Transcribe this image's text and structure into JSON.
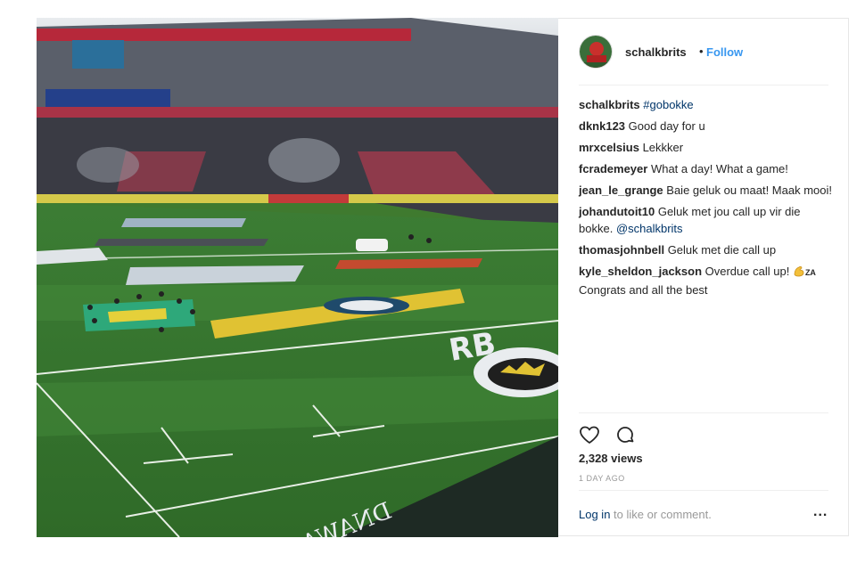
{
  "post": {
    "username": "schalkbrits",
    "separator": "•",
    "follow_label": "Follow",
    "caption": {
      "user": "schalkbrits",
      "hashtag": "#gobokke"
    },
    "comments": [
      {
        "user": "dknk123",
        "text": "Good day for u"
      },
      {
        "user": "mrxcelsius",
        "text": "Lekkker"
      },
      {
        "user": "fcrademeyer",
        "text": "What a day! What a game!"
      },
      {
        "user": "jean_le_grange",
        "text": "Baie geluk ou maat! Maak mooi!"
      },
      {
        "user": "johandutoit10",
        "text": "Geluk met jou call up vir die bokke.",
        "mention": "@schalkbrits"
      },
      {
        "user": "thomasjohnbell",
        "text": "Geluk met die call up"
      },
      {
        "user": "kyle_sheldon_jackson",
        "text": "Overdue call up!",
        "emoji": "flexed-biceps-icon",
        "suffix": "ZA",
        "text2": "Congrats and all the best"
      }
    ],
    "views": "2,328 views",
    "time_ago": "1 DAY AGO",
    "login_link": "Log in",
    "login_text": "to like or comment.",
    "more_label": "..."
  },
  "media": {
    "description_icon": "stadium-video",
    "board_text_1": "RB",
    "board_text_2": "DNAWASCO SIX"
  },
  "colors": {
    "accent": "#3897f0",
    "link": "#003569",
    "muted": "#999999",
    "pitch": "#3f7a2f"
  }
}
